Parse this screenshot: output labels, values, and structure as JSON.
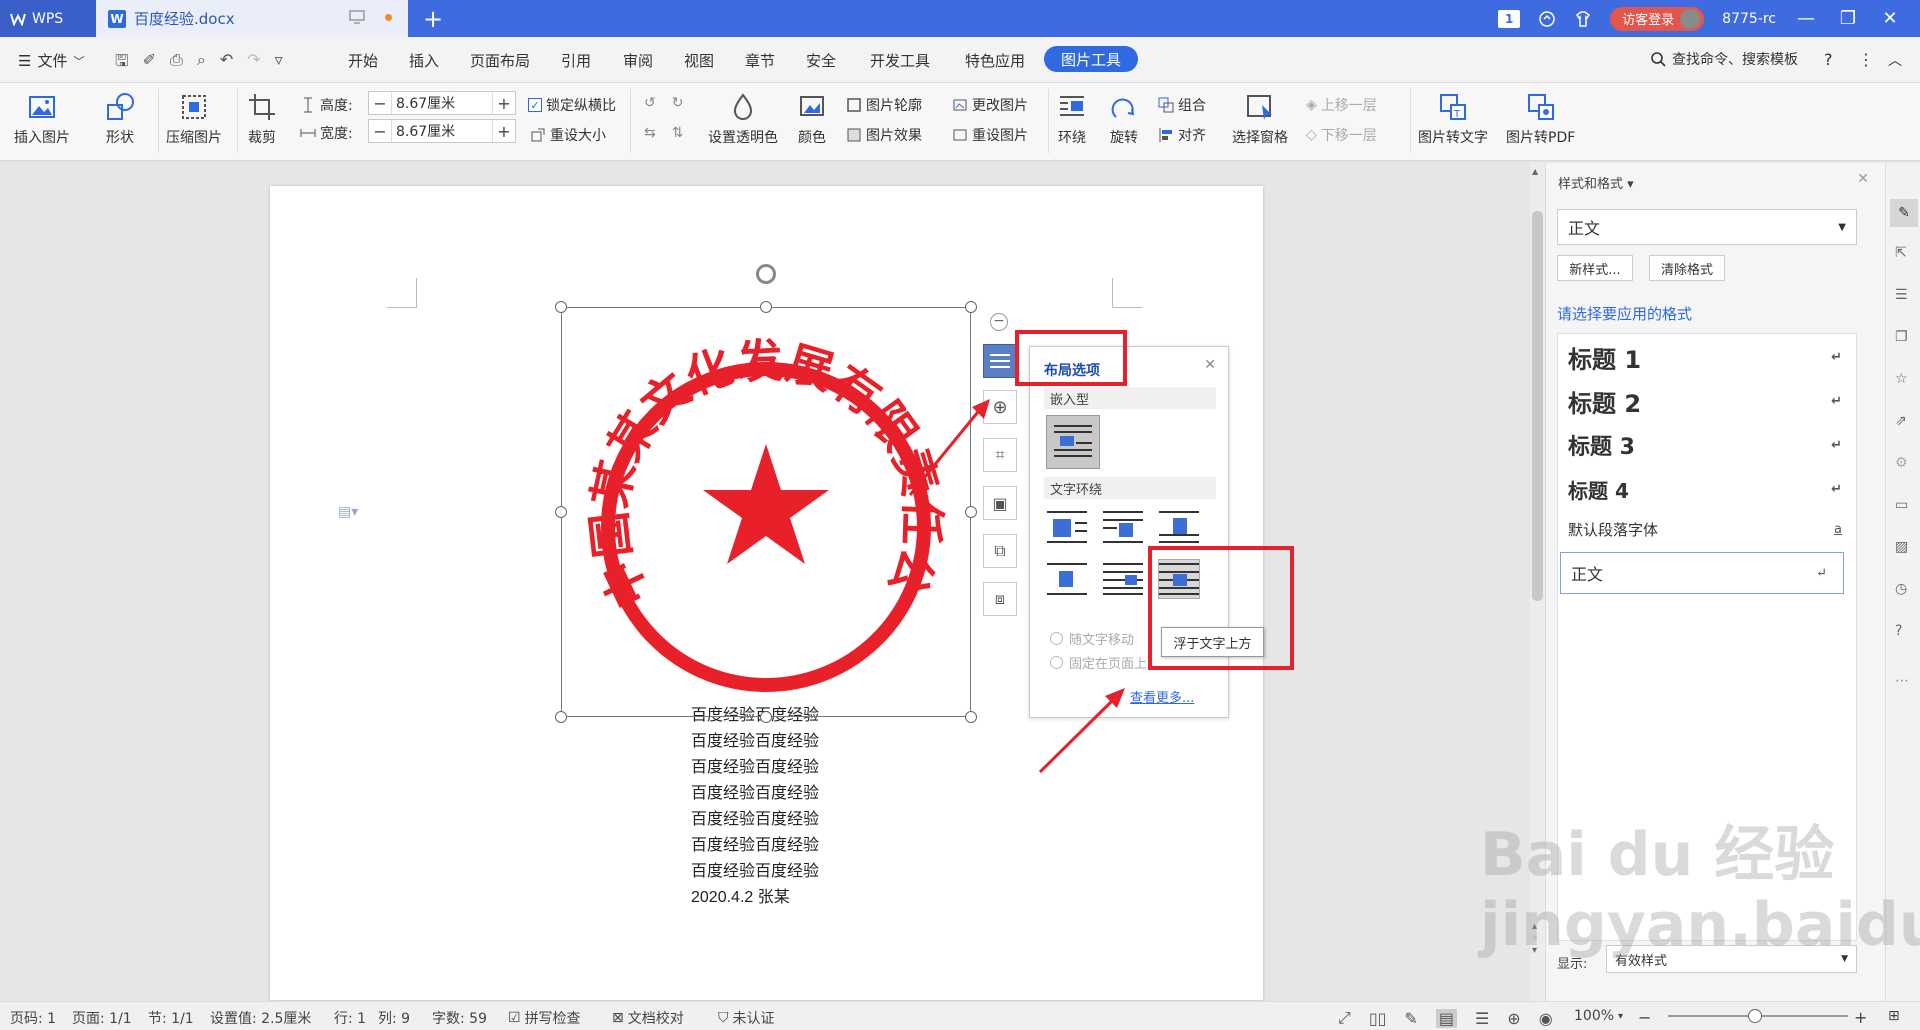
{
  "titlebar": {
    "app_label": "WPS",
    "doc_tab": "百度经验.docx",
    "new_tab": "+",
    "badge_count": "1",
    "login": "访客登录",
    "user": "8775-rc"
  },
  "menu": {
    "file": "文件",
    "tabs": [
      "开始",
      "插入",
      "页面布局",
      "引用",
      "审阅",
      "视图",
      "章节",
      "安全",
      "开发工具",
      "特色应用"
    ],
    "active_tab": "图片工具",
    "search": "查找命令、搜索模板"
  },
  "ribbon": {
    "insert_picture": "插入图片",
    "shape": "形状",
    "compress": "压缩图片",
    "crop": "裁剪",
    "height_label": "高度:",
    "height_value": "8.67厘米",
    "width_label": "宽度:",
    "width_value": "8.67厘米",
    "lock_ratio": "锁定纵横比",
    "reset_size": "重设大小",
    "transparent": "设置透明色",
    "color": "颜色",
    "outline": "图片轮廓",
    "effect": "图片效果",
    "change_pic": "更改图片",
    "reset_pic": "重设图片",
    "wrap": "环绕",
    "rotate": "旋转",
    "group": "组合",
    "align": "对齐",
    "select_pane": "选择窗格",
    "bring_forward": "上移一层",
    "send_backward": "下移一层",
    "pic_to_text": "图片转文字",
    "pic_to_pdf": "图片转PDF"
  },
  "document": {
    "lines": [
      "百度经验百度经验",
      "百度经验百度经验",
      "百度经验百度经验",
      "百度经验百度经验",
      "百度经验百度经验",
      "百度经验百度经验",
      "百度经验百度经验"
    ],
    "signature": "2020.4.2    张某",
    "stamp_text": "中国某某文化发展有限责任公司"
  },
  "layout_panel": {
    "title": "布局选项",
    "inline_section": "嵌入型",
    "wrap_section": "文字环绕",
    "move_with_text": "随文字移动",
    "fixed_on_page": "固定在页面上",
    "see_more": "查看更多...",
    "tooltip": "浮于文字上方"
  },
  "style_pane": {
    "title": "样式和格式",
    "current_style": "正文",
    "new_style": "新样式...",
    "clear_format": "清除格式",
    "apply_hint": "请选择要应用的格式",
    "styles": [
      {
        "name": "标题 1",
        "mark": "↵"
      },
      {
        "name": "标题 2",
        "mark": "↵"
      },
      {
        "name": "标题 3",
        "mark": "↵"
      },
      {
        "name": "标题 4",
        "mark": "↵"
      },
      {
        "name": "默认段落字体",
        "mark": "a"
      },
      {
        "name": "正文",
        "mark": "↵"
      }
    ],
    "show_label": "显示:",
    "show_value": "有效样式"
  },
  "statusbar": {
    "page": "页码: 1",
    "pages": "页面: 1/1",
    "section": "节: 1/1",
    "setting": "设置值: 2.5厘米",
    "row": "行: 1",
    "col": "列: 9",
    "words": "字数: 59",
    "spell": "拼写检查",
    "proof": "文档校对",
    "cert": "未认证",
    "zoom": "100%"
  },
  "watermark": "Bai du 经验  jingyan.baidu.com",
  "colors": {
    "accent": "#2f6ae0",
    "titlebar": "#3f6be0",
    "stamp_red": "#e8202a"
  }
}
